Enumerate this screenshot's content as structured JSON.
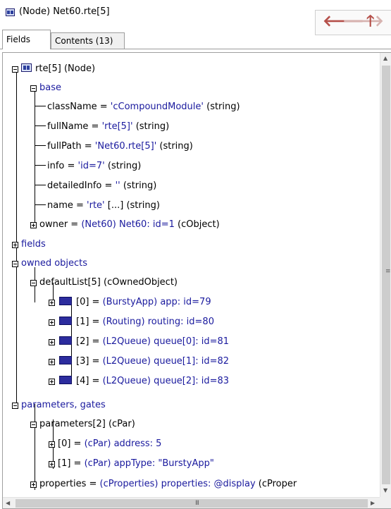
{
  "window": {
    "title": "(Node) Net60.rte[5]",
    "nav": {
      "back": "🡐",
      "forward": "🡒",
      "up": "🡑"
    }
  },
  "tabs": [
    {
      "label": "Fields",
      "active": true
    },
    {
      "label": "Contents (13)",
      "active": false
    }
  ],
  "tree": {
    "root": "rte[5] (Node)",
    "base": {
      "label": "base",
      "items": {
        "className": {
          "key": "className = ",
          "value": "'cCompoundModule'",
          "type": " (string)"
        },
        "fullName": {
          "key": "fullName = ",
          "value": "'rte[5]'",
          "type": " (string)"
        },
        "fullPath": {
          "key": "fullPath = ",
          "value": "'Net60.rte[5]'",
          "type": " (string)"
        },
        "info": {
          "key": "info = ",
          "value": "'id=7'",
          "type": " (string)"
        },
        "detailedInfo": {
          "key": "detailedInfo = ",
          "value": "''",
          "type": " (string)"
        },
        "name": {
          "key": "name = ",
          "value": "'rte'",
          "extra": " [...]",
          "type": "  (string)"
        },
        "owner": {
          "key": "owner = ",
          "value": "(Net60) Net60: id=1",
          "type": " (cObject)"
        }
      }
    },
    "fields": {
      "label": "fields"
    },
    "owned": {
      "label": "owned objects",
      "defaultList": "defaultList[5] (cOwnedObject)",
      "items": [
        {
          "index": "[0] = ",
          "value": "(BurstyApp) app: id=79"
        },
        {
          "index": "[1] = ",
          "value": "(Routing) routing: id=80"
        },
        {
          "index": "[2] = ",
          "value": "(L2Queue) queue[0]: id=81"
        },
        {
          "index": "[3] = ",
          "value": "(L2Queue) queue[1]: id=82"
        },
        {
          "index": "[4] = ",
          "value": "(L2Queue) queue[2]: id=83"
        }
      ]
    },
    "params": {
      "label": "parameters, gates",
      "parameters": "parameters[2] (cPar)",
      "items": [
        {
          "index": "[0] = ",
          "value": "(cPar) address: 5"
        },
        {
          "index": "[1] = ",
          "value": "(cPar) appType: \"BurstyApp\""
        }
      ],
      "properties": {
        "key": "properties = ",
        "value": "(cProperties) properties: @display",
        "type": " (cProper"
      }
    }
  },
  "scrollbars": {
    "vertical_grip": "≡",
    "horizontal_grip": "III",
    "up_arrow": "▲",
    "down_arrow": "▼",
    "left_arrow": "◀",
    "right_arrow": "▶"
  }
}
